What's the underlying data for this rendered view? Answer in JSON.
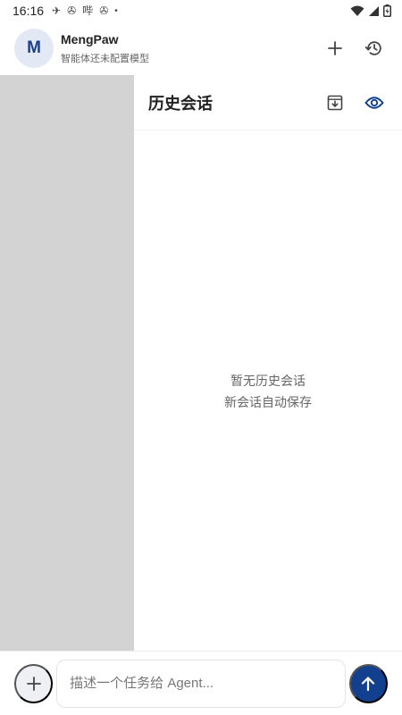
{
  "status_bar": {
    "time": "16:16",
    "notification_icons": [
      "plane-icon",
      "pinwheel-icon",
      "sim-icon",
      "pinwheel-icon"
    ],
    "sim_label": "哔",
    "dot": "•",
    "right_icons": [
      "wifi-icon",
      "signal-icon",
      "battery-icon"
    ]
  },
  "header": {
    "avatar_letter": "M",
    "app_name": "MengPaw",
    "subtitle": "智能体还未配置模型",
    "actions": [
      "add-icon",
      "history-icon"
    ]
  },
  "history": {
    "title": "历史会话",
    "actions": [
      "archive-download-icon",
      "eye-icon"
    ],
    "empty_line1": "暂无历史会话",
    "empty_line2": "新会话自动保存"
  },
  "composer": {
    "placeholder": "描述一个任务给 Agent...",
    "value": ""
  },
  "colors": {
    "accent": "#12408f",
    "avatar_bg": "#e3e9f4",
    "avatar_text": "#1b3f8a",
    "scrim": "#d3d3d3"
  }
}
